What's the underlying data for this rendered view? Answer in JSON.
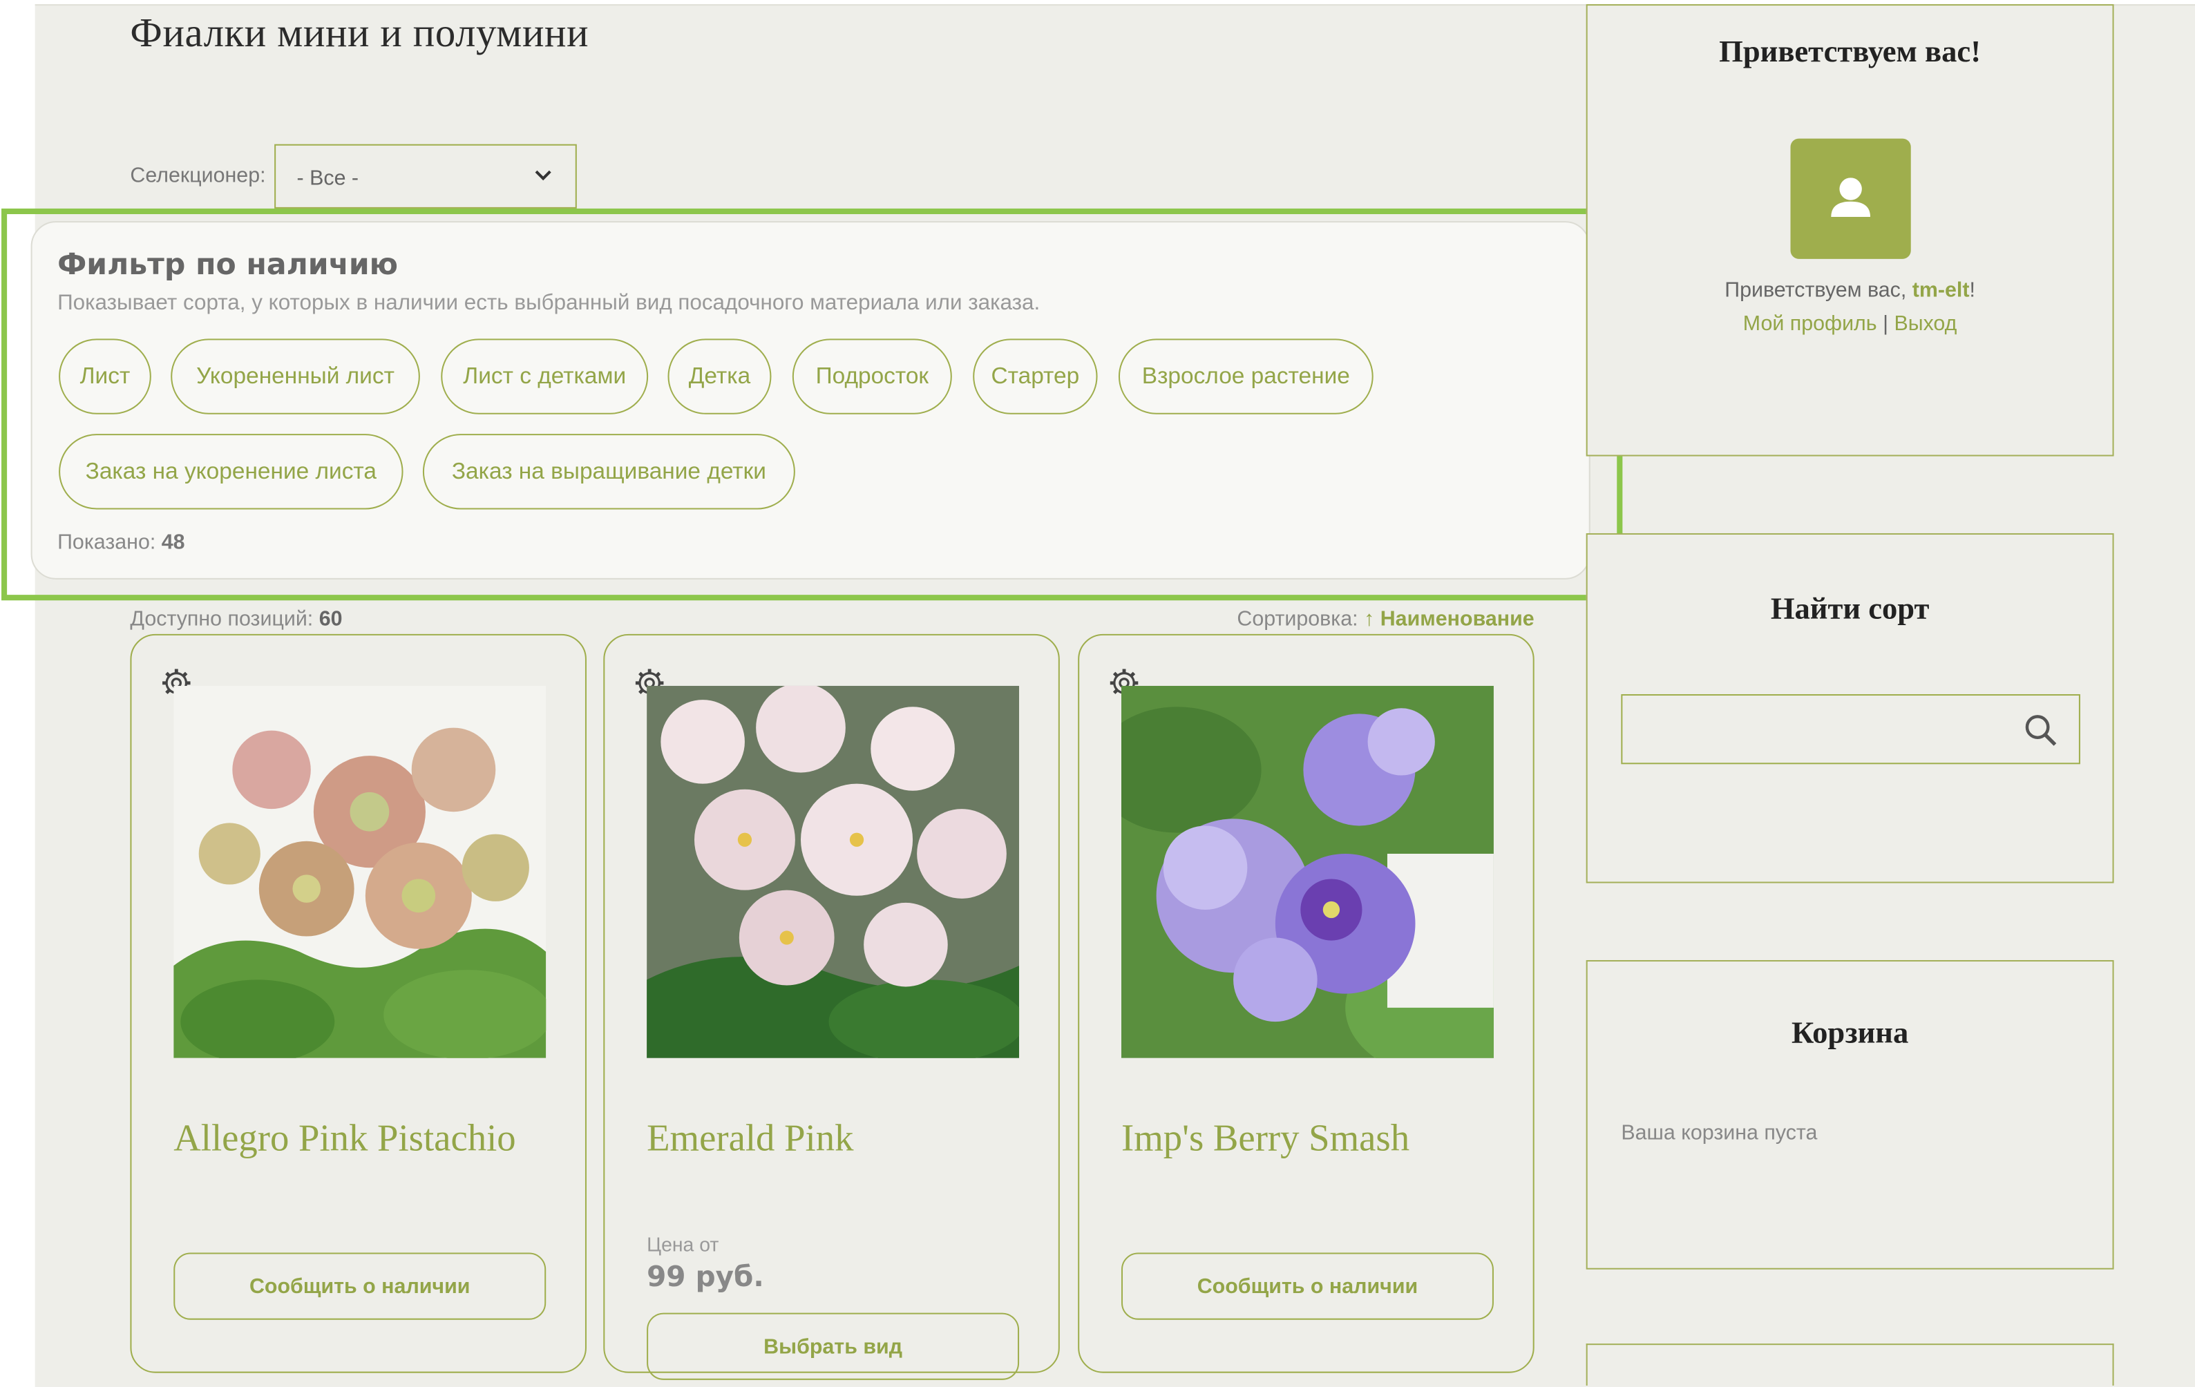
{
  "page": {
    "title": "Фиалки мини и полумини"
  },
  "selector": {
    "label": "Селекционер:",
    "value": "- Все -"
  },
  "filter": {
    "title": "Фильтр по наличию",
    "description": "Показывает сорта, у которых в наличии есть выбранный вид посадочного материала или заказа.",
    "chips": [
      "Лист",
      "Укорененный лист",
      "Лист с детками",
      "Детка",
      "Подросток",
      "Стартер",
      "Взрослое растение",
      "Заказ на укоренение листа",
      "Заказ на выращивание детки"
    ],
    "shown_label": "Показано:",
    "shown_count": "48"
  },
  "listing": {
    "available_label": "Доступно позиций:",
    "available_count": "60",
    "sort_label": "Сортировка:",
    "sort_arrow": "↑",
    "sort_value": "Наименование"
  },
  "cards": [
    {
      "name": "Allegro Pink Pistachio",
      "button": "Сообщить о наличии"
    },
    {
      "name": "Emerald Pink",
      "price_label": "Цена от",
      "price": "99 руб.",
      "button": "Выбрать вид"
    },
    {
      "name": "Imp's Berry Smash",
      "button": "Сообщить о наличии"
    }
  ],
  "sidebar": {
    "welcome": {
      "title": "Приветствуем вас!",
      "greeting": "Приветствуем вас, ",
      "username": "tm-elt",
      "greeting_end": "!",
      "profile_link": "Мой профиль",
      "separator": "|",
      "logout_link": "Выход"
    },
    "search": {
      "title": "Найти сорт",
      "placeholder": ""
    },
    "cart": {
      "title": "Корзина",
      "empty_text": "Ваша корзина пуста"
    }
  },
  "colors": {
    "accent": "#9fae4d",
    "highlight": "#8cc64b",
    "background": "#eeeee9"
  }
}
